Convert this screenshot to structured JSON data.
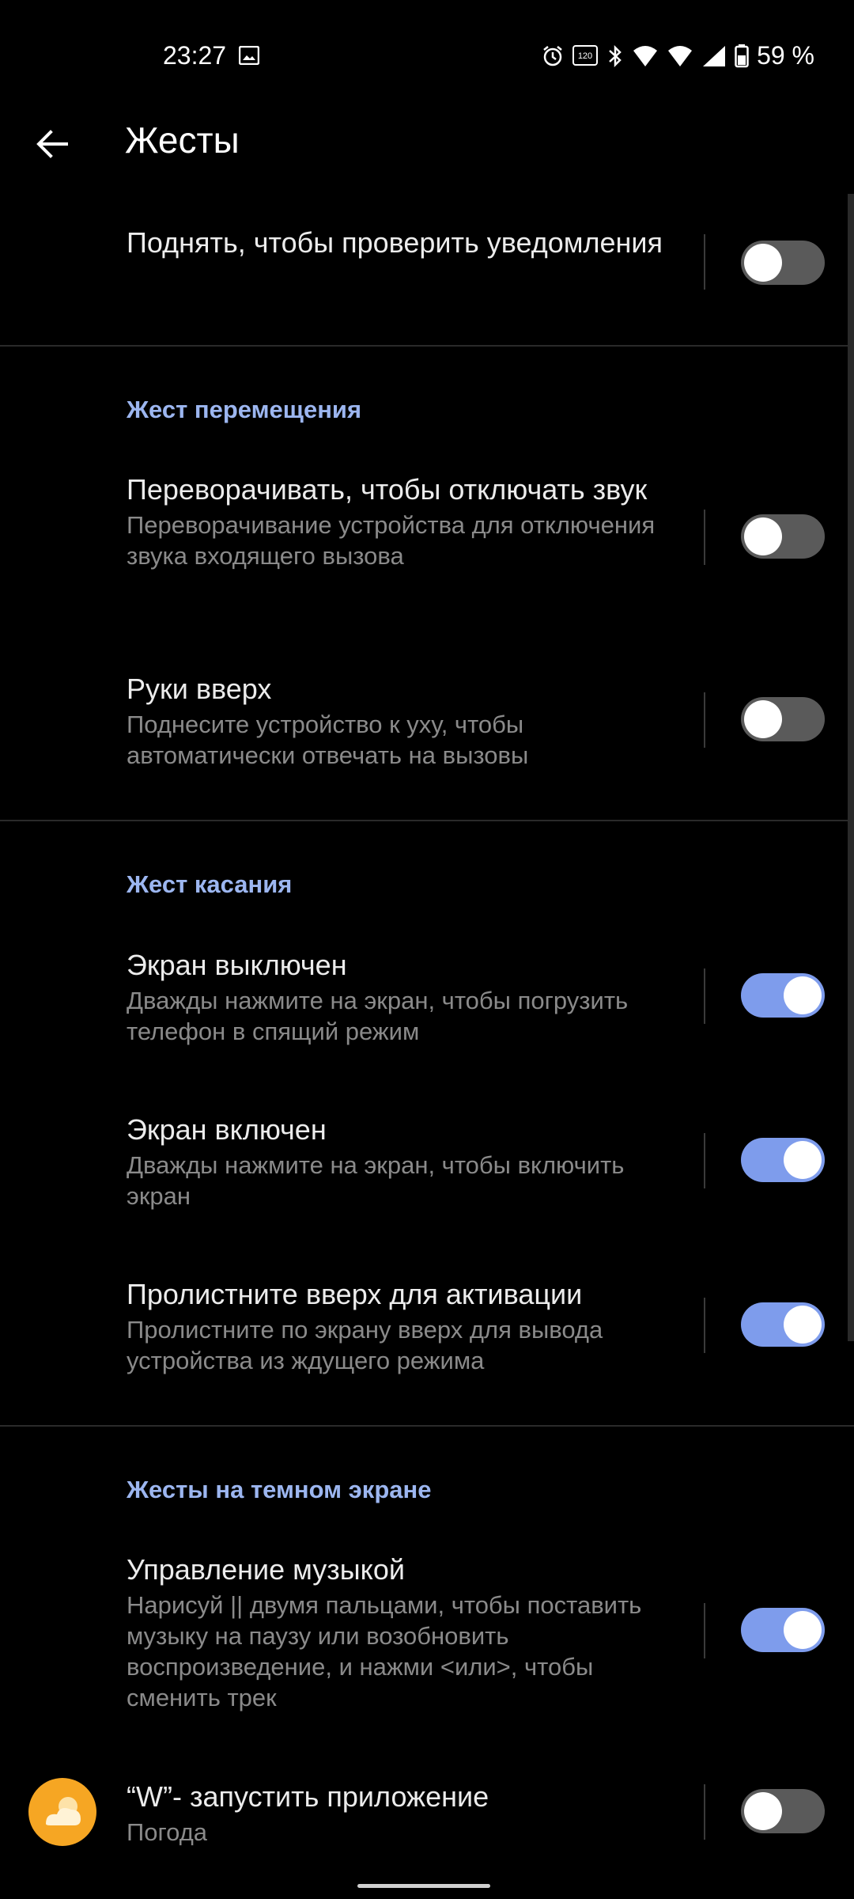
{
  "status_bar": {
    "time": "23:27",
    "battery": "59 %",
    "icons": [
      "image-icon",
      "alarm-icon",
      "refresh-rate-icon",
      "bluetooth-icon",
      "wifi6-icon",
      "wifi6-icon",
      "cell-signal-icon",
      "battery-icon"
    ],
    "refresh_rate_badge": "120"
  },
  "app_bar": {
    "title": "Жесты"
  },
  "items": [
    {
      "title": "Поднять, чтобы проверить уведомления",
      "subtitle": "",
      "enabled": false
    },
    {
      "title": "Переворачивать, чтобы отключать звук",
      "subtitle": "Переворачивание устройства для отключения звука входящего вызова",
      "enabled": false
    },
    {
      "title": "Руки вверх",
      "subtitle": "Поднесите устройство к уху, чтобы автоматически отвечать на вызовы",
      "enabled": false
    },
    {
      "title": "Экран выключен",
      "subtitle": "Дважды нажмите на экран, чтобы погрузить телефон в спящий режим",
      "enabled": true
    },
    {
      "title": "Экран включен",
      "subtitle": "Дважды нажмите на экран, чтобы включить экран",
      "enabled": true
    },
    {
      "title": "Пролистните вверх для активации",
      "subtitle": "Пролистните по экрану вверх для вывода устройства из ждущего режима",
      "enabled": true
    },
    {
      "title": "Управление музыкой",
      "subtitle": "Нарисуй || двумя пальцами, чтобы поставить музыку на паузу или возобновить воспроизведение, и нажми <или>, чтобы сменить трек",
      "enabled": true
    },
    {
      "title": "“W”- запустить приложение",
      "subtitle": "Погода",
      "enabled": false,
      "icon": "weather-icon"
    }
  ],
  "sections": {
    "motion": "Жест перемещения",
    "touch": "Жест касания",
    "dark_screen": "Жесты на темном экране"
  },
  "colors": {
    "background": "#000000",
    "accent": "#7e9cec",
    "section_header": "#9cb6f0",
    "toggle_off": "#5a5a5a"
  }
}
